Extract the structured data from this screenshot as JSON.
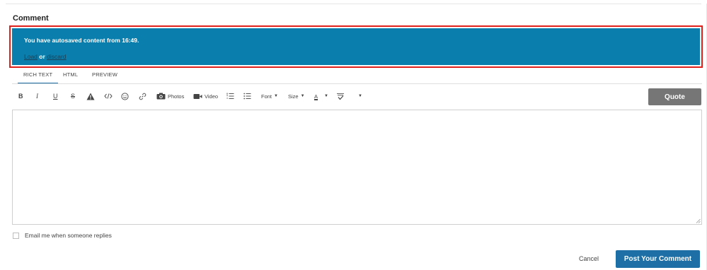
{
  "comment_section": {
    "title": "Comment"
  },
  "autosave_banner": {
    "message": "You have autosaved content from 16:49.",
    "load_label": "Load",
    "or_label": "or",
    "discard_label": "discard"
  },
  "editor_tabs": [
    {
      "label": "RICH TEXT",
      "active": true
    },
    {
      "label": "HTML",
      "active": false
    },
    {
      "label": "PREVIEW",
      "active": false
    }
  ],
  "toolbar": {
    "bold": "B",
    "italic": "I",
    "underline": "U",
    "strike": "S",
    "photos_label": "Photos",
    "video_label": "Video",
    "font_label": "Font",
    "size_label": "Size",
    "text_color_label": "A",
    "quote_label": "Quote"
  },
  "editor": {
    "value": ""
  },
  "email_option": {
    "label": "Email me when someone replies",
    "checked": false
  },
  "actions": {
    "cancel_label": "Cancel",
    "post_label": "Post Your Comment"
  },
  "colors": {
    "banner_bg": "#0a7fad",
    "highlight_border": "#e0201a",
    "primary_button": "#1d6fa5",
    "quote_button": "#767676"
  }
}
